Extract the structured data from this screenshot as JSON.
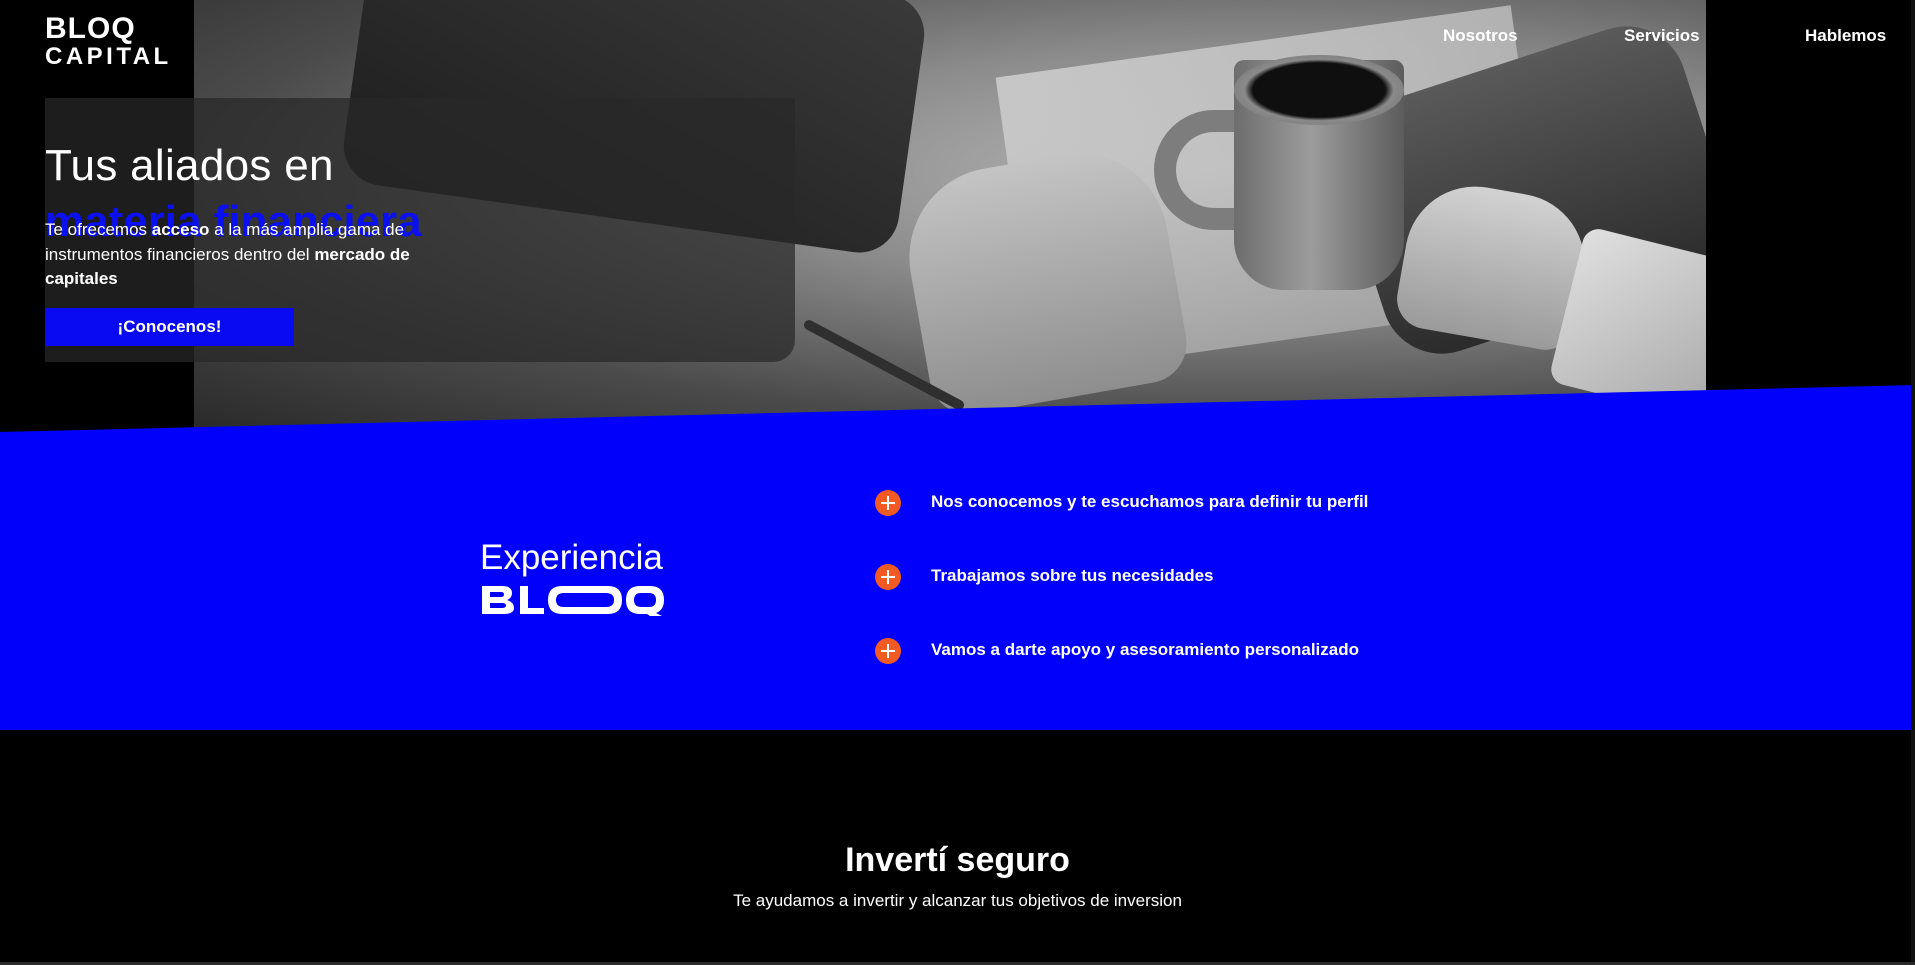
{
  "brand": {
    "logo_line1": "BLOQ",
    "logo_line2": "CAPITAL",
    "primary_color": "#0000fb",
    "accent_color": "#f15a22"
  },
  "nav": {
    "items": [
      {
        "label": "Nosotros"
      },
      {
        "label": "Servicios"
      },
      {
        "label": "Hablemos"
      }
    ]
  },
  "hero": {
    "title_line1": "Tus aliados en",
    "title_line2": "materia financiera",
    "text_part1": "Te ofrecemos ",
    "text_bold1": "acceso",
    "text_part2": " a la más amplia gama de instrumentos financieros dentro del ",
    "text_bold2": "mercado de capitales",
    "cta_label": "¡Conocenos!"
  },
  "experience": {
    "title": "Experiencia",
    "logo_text": "BLOQ",
    "features": [
      {
        "icon": "plus-circle-icon",
        "text": "Nos conocemos y te escuchamos para definir tu perfil"
      },
      {
        "icon": "plus-circle-icon",
        "text": "Trabajamos sobre tus necesidades"
      },
      {
        "icon": "plus-circle-icon",
        "text": "Vamos a darte apoyo y asesoramiento personalizado"
      }
    ]
  },
  "invest": {
    "title": "Invertí seguro",
    "subtitle": "Te ayudamos a invertir y alcanzar tus objetivos de inversion"
  }
}
